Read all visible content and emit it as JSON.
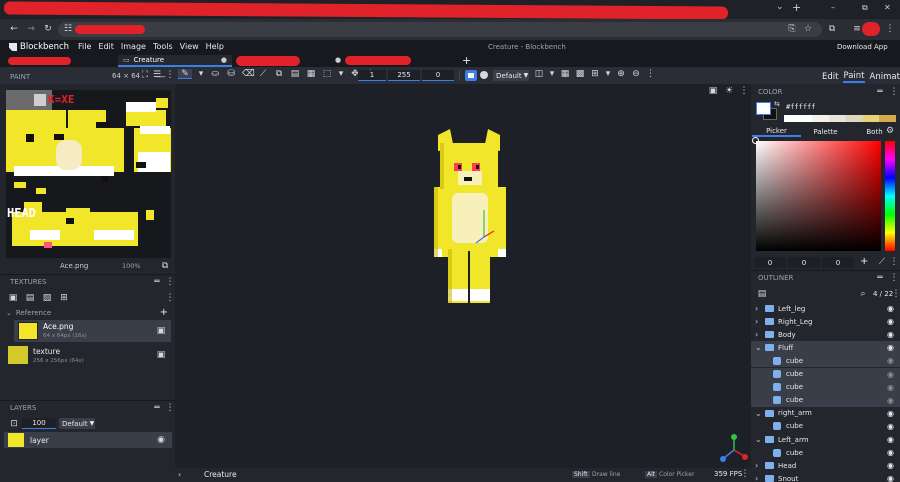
{
  "window": {
    "title": "Creature - Blockbench",
    "minimize": "–",
    "maximize": "⧉",
    "close": "✕",
    "new_tab": "+",
    "chevron": "⌄"
  },
  "menu": {
    "app_name": "Blockbench",
    "items": [
      "File",
      "Edit",
      "Image",
      "Tools",
      "View",
      "Help"
    ],
    "download": "Download App"
  },
  "tabs": [
    {
      "label": "Creature"
    }
  ],
  "toolbar": {
    "size": "1",
    "opacity": "255",
    "offset": "0",
    "blend_mode": "Default"
  },
  "modes": [
    "Edit",
    "Paint",
    "Animate"
  ],
  "paint_panel": {
    "title": "PAINT",
    "size": "64 × 64",
    "texture_name": "Ace.png",
    "zoom": "100%",
    "canvas_text_1": "HEAD",
    "canvas_text_2": "K=XE"
  },
  "textures_panel": {
    "title": "TEXTURES",
    "group": "Reference",
    "items": [
      {
        "name": "Ace.png",
        "info": "64 x 64px (16x)"
      },
      {
        "name": "texture",
        "info": "256 x 256px (64x)"
      }
    ]
  },
  "layers_panel": {
    "title": "LAYERS",
    "opacity": "100",
    "blend": "Default",
    "layer_name": "layer"
  },
  "color_panel": {
    "title": "COLOR",
    "hex": "#ffffff",
    "tabs": [
      "Picker",
      "Palette",
      "Both"
    ],
    "values": [
      "0",
      "0",
      "0"
    ]
  },
  "outliner": {
    "title": "OUTLINER",
    "count": "4 / 22",
    "items": [
      {
        "label": "Left_leg",
        "type": "folder",
        "open": false,
        "indent": 0,
        "selected": false
      },
      {
        "label": "Right_Leg",
        "type": "folder",
        "open": false,
        "indent": 0,
        "selected": false
      },
      {
        "label": "Body",
        "type": "folder",
        "open": false,
        "indent": 0,
        "selected": false
      },
      {
        "label": "Fluff",
        "type": "folder",
        "open": true,
        "indent": 0,
        "selected": true
      },
      {
        "label": "cube",
        "type": "cube",
        "indent": 1,
        "selected": true
      },
      {
        "label": "cube",
        "type": "cube",
        "indent": 1,
        "selected": true
      },
      {
        "label": "cube",
        "type": "cube",
        "indent": 1,
        "selected": true
      },
      {
        "label": "cube",
        "type": "cube",
        "indent": 1,
        "selected": true
      },
      {
        "label": "right_arm",
        "type": "folder",
        "open": true,
        "indent": 0,
        "selected": false
      },
      {
        "label": "cube",
        "type": "cube",
        "indent": 1,
        "selected": false
      },
      {
        "label": "Left_arm",
        "type": "folder",
        "open": true,
        "indent": 0,
        "selected": false
      },
      {
        "label": "cube",
        "type": "cube",
        "indent": 1,
        "selected": false
      },
      {
        "label": "Head",
        "type": "folder",
        "open": false,
        "indent": 0,
        "selected": false
      },
      {
        "label": "Snout",
        "type": "folder",
        "open": false,
        "indent": 0,
        "selected": false
      }
    ]
  },
  "status": {
    "tab": "Creature",
    "shift_key": "Shift",
    "shift_action": "Draw line",
    "alt_key": "Alt",
    "alt_action": "Color Picker",
    "fps": "359 FPS"
  },
  "accent": "#3d7de8",
  "yellow": "#f2e62a"
}
